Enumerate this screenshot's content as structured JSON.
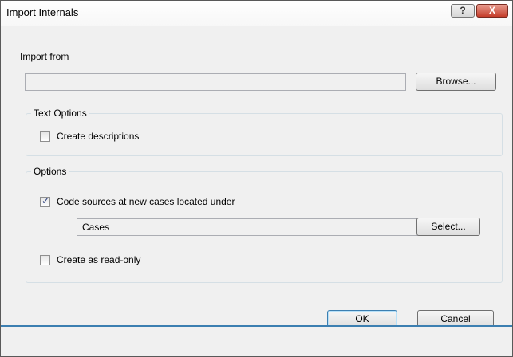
{
  "window": {
    "title": "Import Internals",
    "help_label": "?",
    "close_label": "X"
  },
  "import_from": {
    "label": "Import from",
    "value": "",
    "browse_label": "Browse..."
  },
  "text_options": {
    "legend": "Text Options",
    "create_descriptions": {
      "label": "Create descriptions",
      "checked": false
    }
  },
  "options": {
    "legend": "Options",
    "code_sources": {
      "label": "Code sources at new cases located under",
      "checked": true
    },
    "cases_value": "Cases",
    "select_label": "Select...",
    "read_only": {
      "label": "Create as read-only",
      "checked": false
    }
  },
  "footer": {
    "ok_label": "OK",
    "cancel_label": "Cancel"
  },
  "colors": {
    "accent": "#3c7fb1",
    "close_button": "#c43c2a"
  }
}
